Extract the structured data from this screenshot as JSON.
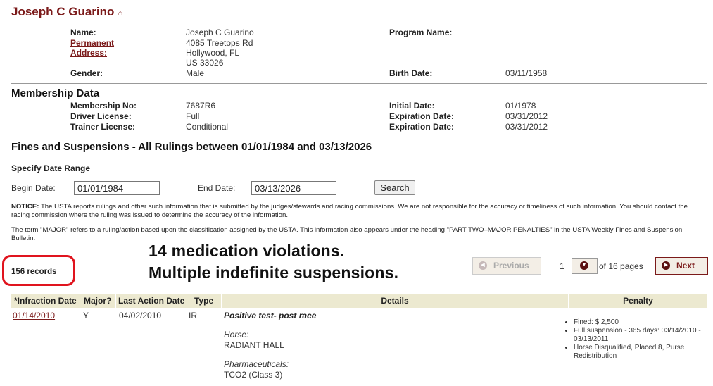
{
  "person": {
    "name": "Joseph C Guarino",
    "house_icon": "house-icon"
  },
  "profile": {
    "name_label": "Name:",
    "name_value": "Joseph C Guarino",
    "address_label_1": "Permanent",
    "address_label_2": "Address:",
    "address_lines": [
      "4085 Treetops Rd",
      "Hollywood, FL",
      "US 33026"
    ],
    "gender_label": "Gender:",
    "gender_value": "Male",
    "program_label": "Program Name:",
    "birth_label": "Birth Date:",
    "birth_value": "03/11/1958"
  },
  "membership": {
    "heading": "Membership Data",
    "no_label": "Membership No:",
    "no_value": "7687R6",
    "driver_label": "Driver License:",
    "driver_value": "Full",
    "trainer_label": "Trainer License:",
    "trainer_value": "Conditional",
    "initial_label": "Initial Date:",
    "initial_value": "01/1978",
    "exp1_label": "Expiration Date:",
    "exp1_value": "03/31/2012",
    "exp2_label": "Expiration Date:",
    "exp2_value": "03/31/2012"
  },
  "fines": {
    "heading": "Fines and Suspensions - All Rulings between 01/01/1984 and 03/13/2026",
    "specify_label": "Specify Date Range",
    "begin_label": "Begin Date:",
    "begin_value": "01/01/1984",
    "end_label": "End Date:",
    "end_value": "03/13/2026",
    "search_label": "Search",
    "notice_bold": "NOTICE:",
    "notice_text": " The USTA reports rulings and other such information that is submitted by the judges/stewards and racing commissions. We are not responsible for the accuracy or timeliness of such information. You should contact the racing commission where the ruling was issued to determine the accuracy of the information.",
    "major_note": "The term \"MAJOR\" refers to a ruling/action based upon the classification assigned by the USTA. This information also appears under the heading \"PART TWO–MAJOR PENALTIES\" in the USTA Weekly Fines and Suspension Bulletin."
  },
  "annotation": {
    "line1": "14 medication violations.",
    "line2": "Multiple indefinite suspensions.",
    "circle_color": "#e0141e"
  },
  "records": {
    "count_label": "156 records"
  },
  "pager": {
    "previous_label": "Previous",
    "next_label": "Next",
    "current_page": "1",
    "of_pages": "of 16 pages"
  },
  "table": {
    "columns": [
      "*Infraction Date",
      "Major?",
      "Last Action Date",
      "Type",
      "Details",
      "Penalty"
    ],
    "rows": [
      {
        "infraction_date": "01/14/2010",
        "major": "Y",
        "last_action_date": "04/02/2010",
        "type": "IR",
        "details_title": "Positive test- post race",
        "horse_label": "Horse:",
        "horse_value": "RADIANT HALL",
        "pharma_label": "Pharmaceuticals:",
        "pharma_value": "TCO2 (Class 3)",
        "penalties": [
          "Fined: $ 2,500",
          "Full suspension - 365 days: 03/14/2010 - 03/13/2011",
          "Horse  Disqualified, Placed 8, Purse Redistribution"
        ]
      }
    ]
  },
  "colors": {
    "brand": "#7b1a1a",
    "table_header": "#ece9d0"
  }
}
